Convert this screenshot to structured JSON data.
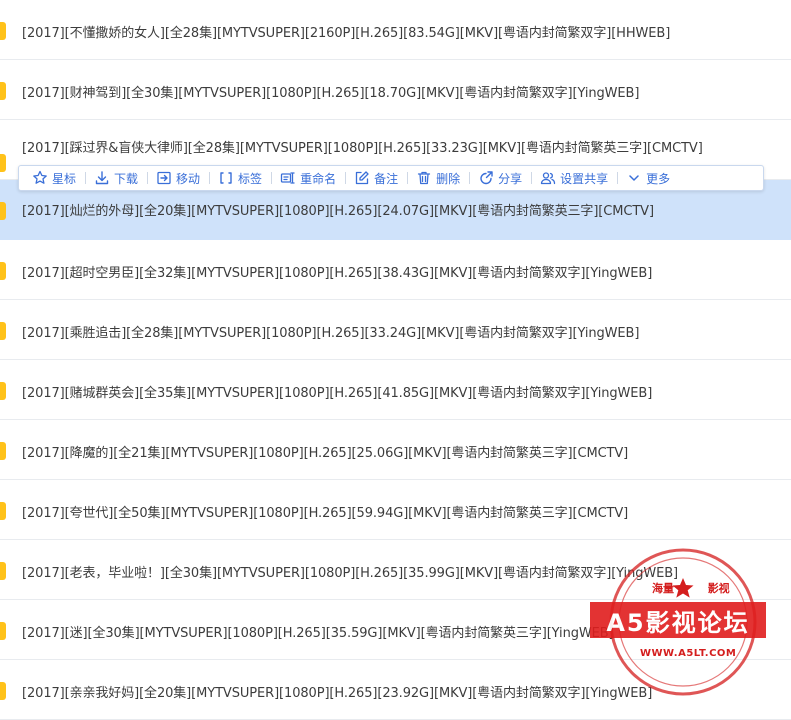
{
  "files": [
    {
      "name": "[2017][不懂撒娇的女人][全28集][MYTVSUPER][2160P][H.265][83.54G][MKV][粤语内封简繁双字][HHWEB]"
    },
    {
      "name": "[2017][财神驾到][全30集][MYTVSUPER][1080P][H.265][18.70G][MKV][粤语内封简繁双字][YingWEB]"
    },
    {
      "name": "[2017][踩过界&盲侠大律师][全28集][MYTVSUPER][1080P][H.265][33.23G][MKV][粤语内封简繁英三字][CMCTV]"
    },
    {
      "name": "[2017][灿烂的外母][全20集][MYTVSUPER][1080P][H.265][24.07G][MKV][粤语内封简繁英三字][CMCTV]"
    },
    {
      "name": "[2017][超时空男臣][全32集][MYTVSUPER][1080P][H.265][38.43G][MKV][粤语内封简繁双字][YingWEB]"
    },
    {
      "name": "[2017][乘胜追击][全28集][MYTVSUPER][1080P][H.265][33.24G][MKV][粤语内封简繁双字][YingWEB]"
    },
    {
      "name": "[2017][赌城群英会][全35集][MYTVSUPER][1080P][H.265][41.85G][MKV][粤语内封简繁双字][YingWEB]"
    },
    {
      "name": "[2017][降魔的][全21集][MYTVSUPER][1080P][H.265][25.06G][MKV][粤语内封简繁英三字][CMCTV]"
    },
    {
      "name": "[2017][夸世代][全50集][MYTVSUPER][1080P][H.265][59.94G][MKV][粤语内封简繁英三字][CMCTV]"
    },
    {
      "name": "[2017][老表，毕业啦！][全30集][MYTVSUPER][1080P][H.265][35.99G][MKV][粤语内封简繁双字][YingWEB]"
    },
    {
      "name": "[2017][迷][全30集][MYTVSUPER][1080P][H.265][35.59G][MKV][粤语内封简繁英三字][YingWEB]"
    },
    {
      "name": "[2017][亲亲我好妈][全20集][MYTVSUPER][1080P][H.265][23.92G][MKV][粤语内封简繁双字][YingWEB]"
    }
  ],
  "selected_index": 3,
  "toolbar": {
    "items": [
      {
        "label": "星标",
        "icon": "star-icon"
      },
      {
        "label": "下载",
        "icon": "download-icon"
      },
      {
        "label": "移动",
        "icon": "move-icon"
      },
      {
        "label": "标签",
        "icon": "tag-icon"
      },
      {
        "label": "重命名",
        "icon": "rename-icon"
      },
      {
        "label": "备注",
        "icon": "note-icon"
      },
      {
        "label": "删除",
        "icon": "delete-icon"
      },
      {
        "label": "分享",
        "icon": "share-icon"
      },
      {
        "label": "设置共享",
        "icon": "shared-users-icon"
      },
      {
        "label": "更多",
        "icon": "chevron-down-icon"
      }
    ]
  },
  "watermark": {
    "top_left": "海量",
    "top_right": "影视",
    "title": "A5影视论坛",
    "url": "WWW.A5LT.COM"
  },
  "colors": {
    "accent": "#3a6fd8",
    "selected_row": "#cfe2fa",
    "folder": "#ffc21a",
    "stamp": "#e01e1e"
  }
}
